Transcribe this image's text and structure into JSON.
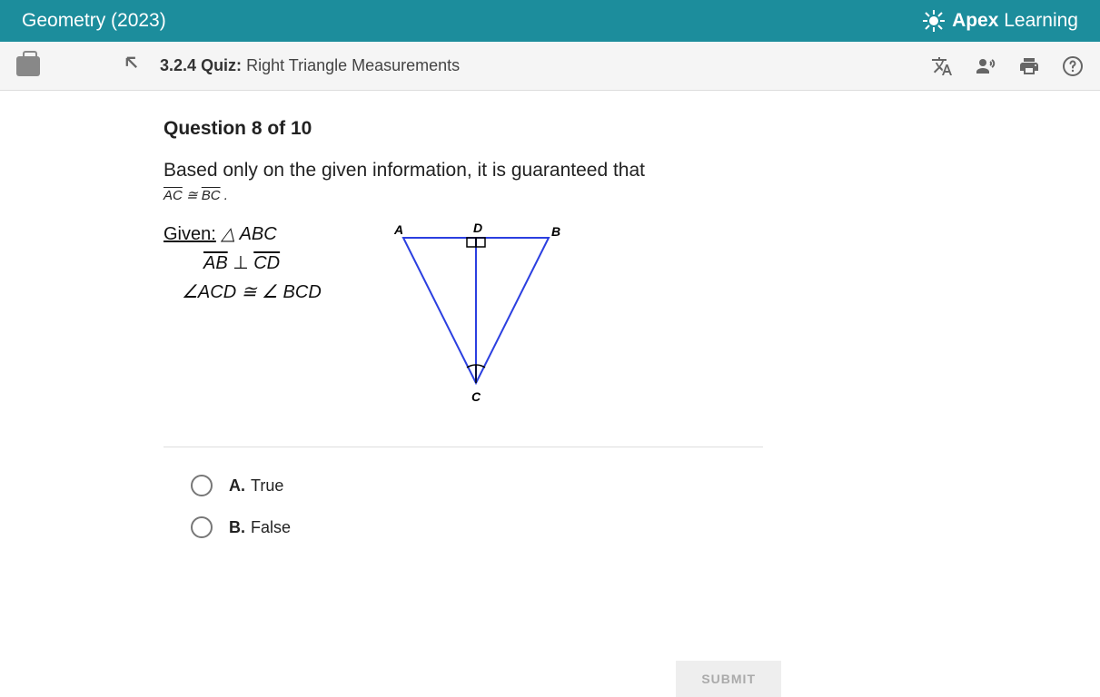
{
  "header": {
    "course_title": "Geometry (2023)",
    "brand": "Apex Learning"
  },
  "toolbar": {
    "section": "3.2.4",
    "label": "Quiz:",
    "desc": "Right Triangle Measurements"
  },
  "question": {
    "counter": "Question 8 of 10",
    "prompt": "Based only on the given information, it is guaranteed that",
    "conclusion_left": "AC",
    "conclusion_rel": "≅",
    "conclusion_right": "BC",
    "given_label": "Given:",
    "given_tri": "△ ABC",
    "given_line2_left": "AB",
    "given_line2_sym": "⊥",
    "given_line2_right": "CD",
    "given_line3_left": "∠ACD",
    "given_line3_rel": "≅",
    "given_line3_right": "∠ BCD",
    "diagram_labels": {
      "A": "A",
      "B": "B",
      "C": "C",
      "D": "D"
    }
  },
  "options": [
    {
      "letter": "A.",
      "text": "True"
    },
    {
      "letter": "B.",
      "text": "False"
    }
  ],
  "submit_label": "SUBMIT"
}
